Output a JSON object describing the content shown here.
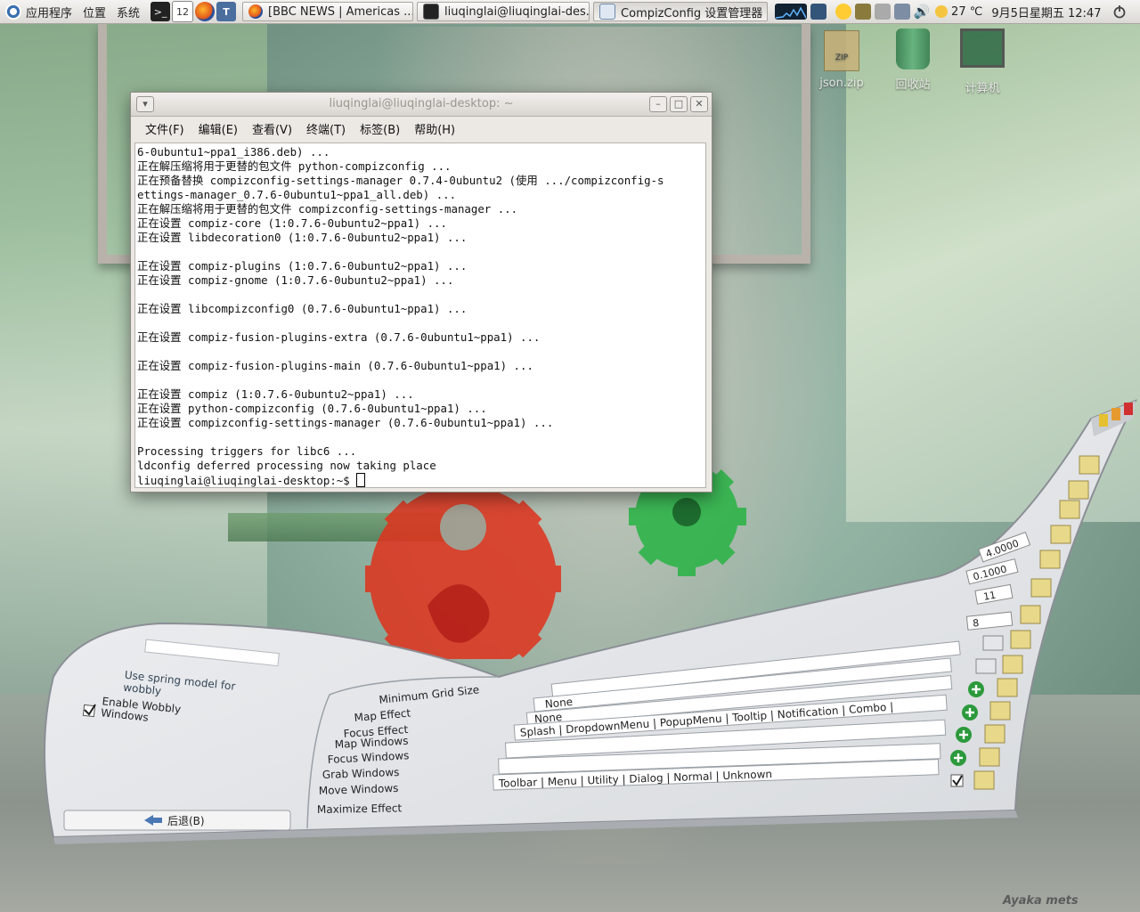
{
  "top_panel": {
    "menus": [
      "应用程序",
      "位置",
      "系统"
    ],
    "calendar_day": "12",
    "tasks": [
      {
        "label": "[BBC NEWS | Americas ..."
      },
      {
        "label": "liuqinglai@liuqinglai-des..."
      },
      {
        "label": "CompizConfig 设置管理器"
      }
    ],
    "weather": "27 ℃",
    "clock": "9月5日星期五 12:47"
  },
  "desktop_icons": [
    {
      "label": "json.zip",
      "badge": "ZIP"
    },
    {
      "label": "回收站"
    },
    {
      "label": "计算机"
    }
  ],
  "terminal": {
    "title": "liuqinglai@liuqinglai-desktop: ~",
    "menu": [
      "文件(F)",
      "编辑(E)",
      "查看(V)",
      "终端(T)",
      "标签(B)",
      "帮助(H)"
    ],
    "lines": [
      "6-0ubuntu1~ppa1_i386.deb) ...",
      "正在解压缩将用于更替的包文件 python-compizconfig ...",
      "正在预备替换 compizconfig-settings-manager 0.7.4-0ubuntu2 (使用 .../compizconfig-s",
      "ettings-manager_0.7.6-0ubuntu1~ppa1_all.deb) ...",
      "正在解压缩将用于更替的包文件 compizconfig-settings-manager ...",
      "正在设置 compiz-core (1:0.7.6-0ubuntu2~ppa1) ...",
      "正在设置 libdecoration0 (1:0.7.6-0ubuntu2~ppa1) ...",
      "",
      "正在设置 compiz-plugins (1:0.7.6-0ubuntu2~ppa1) ...",
      "正在设置 compiz-gnome (1:0.7.6-0ubuntu2~ppa1) ...",
      "",
      "正在设置 libcompizconfig0 (0.7.6-0ubuntu1~ppa1) ...",
      "",
      "正在设置 compiz-fusion-plugins-extra (0.7.6-0ubuntu1~ppa1) ...",
      "",
      "正在设置 compiz-fusion-plugins-main (0.7.6-0ubuntu1~ppa1) ...",
      "",
      "正在设置 compiz (1:0.7.6-0ubuntu2~ppa1) ...",
      "正在设置 python-compizconfig (0.7.6-0ubuntu1~ppa1) ...",
      "正在设置 compizconfig-settings-manager (0.7.6-0ubuntu1~ppa1) ...",
      "",
      "Processing triggers for libc6 ...",
      "ldconfig deferred processing now taking place",
      "liuqinglai@liuqinglai-desktop:~$ "
    ]
  },
  "ccsm": {
    "left_items": [
      "Use spring model for",
      "wobbly",
      "Enable Wobbly",
      "Windows"
    ],
    "back_button": "后退(B)",
    "setting_labels": [
      "Minimum Grid Size",
      "Map Effect",
      "Focus Effect",
      "Map Windows",
      "Focus Windows",
      "Grab Windows",
      "Move Windows",
      "Maximize Effect"
    ],
    "field_values": [
      "None",
      "None",
      "Splash | DropdownMenu | PopupMenu | Tooltip | Notification | Combo |",
      "",
      "",
      "Toolbar | Menu | Utility | Dialog | Normal | Unknown"
    ],
    "spin_values": [
      "4.0000",
      "0.1000",
      "11",
      "8"
    ]
  },
  "watermark": "Ayaka mets"
}
